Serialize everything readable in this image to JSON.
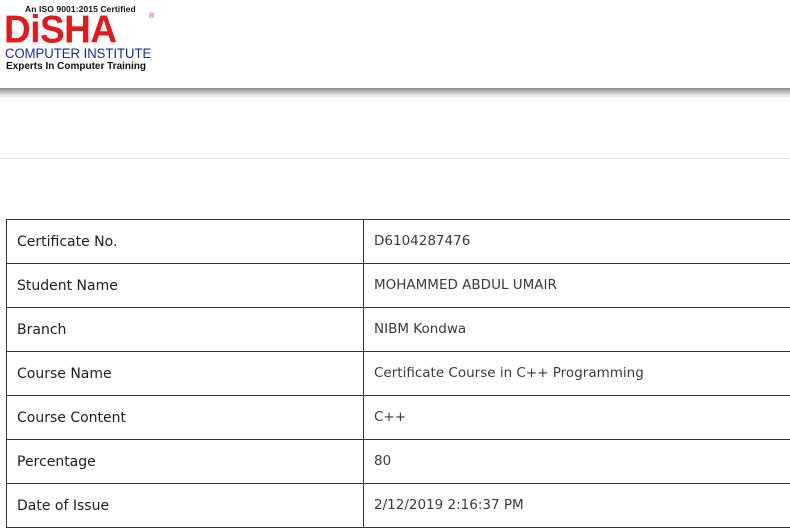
{
  "header": {
    "logo": {
      "iso_text": "An ISO 9001:2015 Certified",
      "brand": "DiSHA",
      "registered_mark": "®",
      "subtitle": "COMPUTER INSTITUTE",
      "tagline": "Experts In Computer Training"
    }
  },
  "colors": {
    "brand_red": "#e11b1b",
    "brand_blue": "#1b2a8a",
    "table_border": "#333333"
  },
  "certificate": {
    "rows": [
      {
        "label": "Certificate No.",
        "value": "D6104287476"
      },
      {
        "label": "Student Name",
        "value": "MOHAMMED ABDUL UMAIR"
      },
      {
        "label": "Branch",
        "value": "NIBM Kondwa"
      },
      {
        "label": "Course Name",
        "value": "Certificate Course in C++ Programming"
      },
      {
        "label": "Course Content",
        "value": "C++"
      },
      {
        "label": "Percentage",
        "value": "80"
      },
      {
        "label": "Date of Issue",
        "value": "2/12/2019 2:16:37 PM"
      }
    ]
  }
}
